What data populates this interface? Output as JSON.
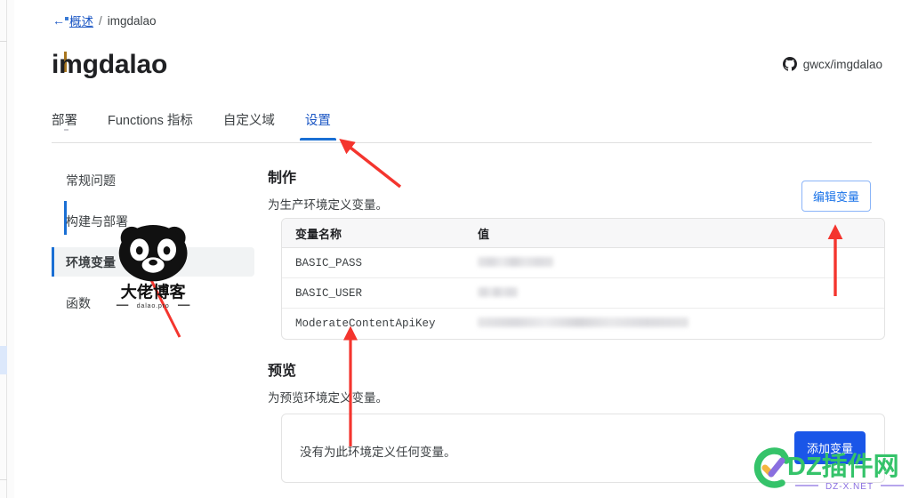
{
  "breadcrumb": {
    "back_icon": "arrow-left-icon",
    "link": "概述",
    "separator": "/",
    "current": "imgdalao"
  },
  "header": {
    "title": "imgdalao",
    "repo_icon": "github-icon",
    "repo": "gwcx/imgdalao"
  },
  "tabs": [
    {
      "label": "部署",
      "active": false
    },
    {
      "label": "Functions 指标",
      "active": false
    },
    {
      "label": "自定义域",
      "active": false
    },
    {
      "label": "设置",
      "active": true
    }
  ],
  "sidebar": {
    "items": [
      {
        "label": "常规问题",
        "active": false
      },
      {
        "label": "构建与部署",
        "active": false
      },
      {
        "label": "环境变量",
        "active": true
      },
      {
        "label": "函数",
        "active": false
      }
    ]
  },
  "production": {
    "title": "制作",
    "description": "为生产环境定义变量。",
    "edit_button": "编辑变量",
    "table": {
      "columns": [
        "变量名称",
        "值"
      ],
      "rows": [
        {
          "name": "BASIC_PASS",
          "value": "",
          "value_redacted": true,
          "redacted_width": 85
        },
        {
          "name": "BASIC_USER",
          "value": "",
          "value_redacted": true,
          "redacted_width": 45
        },
        {
          "name": "ModerateContentApiKey",
          "value": "",
          "value_redacted": true,
          "redacted_width": 237
        }
      ]
    }
  },
  "preview": {
    "title": "预览",
    "description": "为预览环境定义变量。",
    "empty_message": "没有为此环境定义任何变量。",
    "add_button": "添加变量"
  },
  "annotations": [
    {
      "name": "arrow-to-settings-tab",
      "style": "diagonal"
    },
    {
      "name": "arrow-to-env-vars-sidebar",
      "style": "diagonal"
    },
    {
      "name": "arrow-to-variables-table",
      "style": "vertical"
    },
    {
      "name": "arrow-to-edit-button",
      "style": "vertical"
    }
  ],
  "watermarks": {
    "panda": {
      "title": "大佬博客",
      "subtitle": "dalao.pro"
    },
    "dz": {
      "title": "DZ插件网",
      "subtitle": "DZ-X.NET"
    }
  },
  "colors": {
    "accent_blue": "#1a6fd4",
    "link_blue": "#1a56c4",
    "primary_button": "#1a56e8",
    "annotation_red": "#f4352e",
    "panda_black": "#111111",
    "dz_green": "#35c36a",
    "dz_purple": "#8a6fe0"
  }
}
